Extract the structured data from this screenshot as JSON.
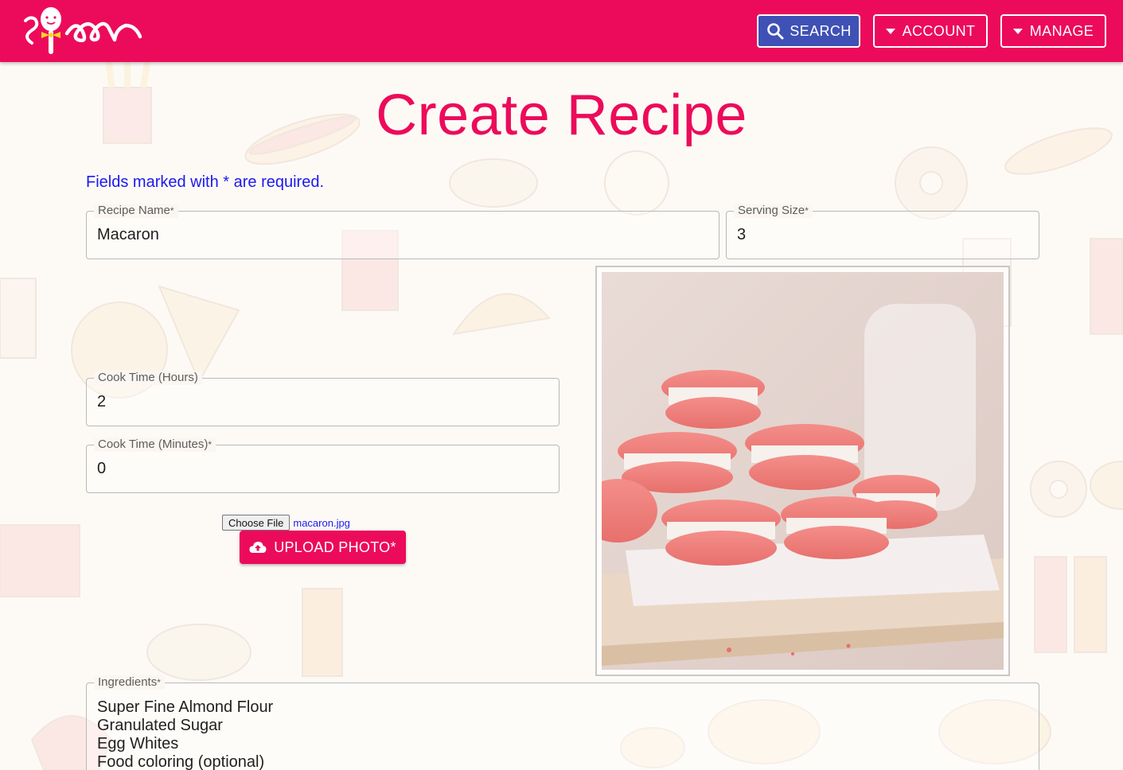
{
  "header": {
    "logo_text": "spoon",
    "nav": {
      "search_label": "SEARCH",
      "account_label": "ACCOUNT",
      "manage_label": "MANAGE"
    }
  },
  "page": {
    "title": "Create Recipe",
    "required_note": "Fields marked with * are required."
  },
  "form": {
    "recipe_name": {
      "label": "Recipe Name",
      "required_mark": "*",
      "value": "Macaron"
    },
    "serving_size": {
      "label": "Serving Size",
      "required_mark": "*",
      "value": "3"
    },
    "cook_hours": {
      "label": "Cook Time (Hours)",
      "value": "2"
    },
    "cook_minutes": {
      "label": "Cook Time (Minutes)",
      "required_mark": "*",
      "value": "0"
    },
    "file": {
      "choose_label": "Choose File",
      "file_name": "macaron.jpg"
    },
    "upload": {
      "label": "UPLOAD PHOTO*"
    },
    "ingredients": {
      "label": "Ingredients",
      "required_mark": "*",
      "items": [
        "Super Fine Almond Flour",
        "Granulated Sugar",
        "Egg Whites",
        "Food coloring (optional)"
      ]
    }
  },
  "colors": {
    "brand": "#ec0b5a",
    "search_button": "#3f51b5",
    "required_note": "#1a1af0"
  },
  "icons": {
    "search": "search-icon",
    "account_caret": "caret-down-icon",
    "manage_caret": "caret-down-icon",
    "upload": "cloud-upload-icon"
  }
}
